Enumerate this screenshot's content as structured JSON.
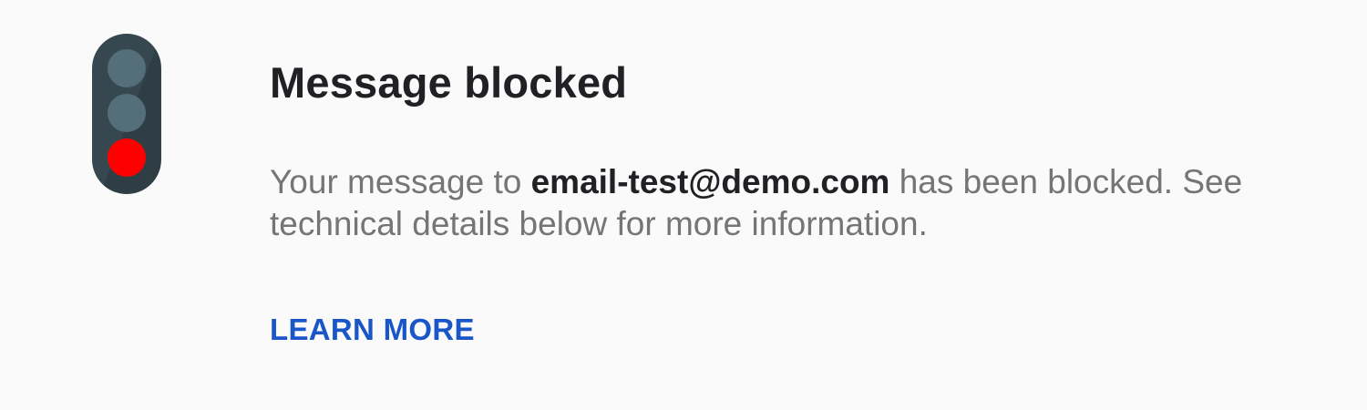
{
  "notice": {
    "title": "Message blocked",
    "message_before": "Your message to ",
    "recipient_email": "email-test@demo.com",
    "message_after": " has been blocked. See technical details below for more information.",
    "learn_more_label": "LEARN MORE"
  },
  "icon": {
    "name": "traffic-light-icon",
    "active_light": "red",
    "colors": {
      "housing": "#37474f",
      "inactive_light": "#546e7a",
      "active_light": "#ff0000",
      "shadow": "#263238"
    }
  },
  "colors": {
    "background": "#fafafa",
    "title": "#202124",
    "body_text": "#757575",
    "link": "#1a56c8"
  }
}
